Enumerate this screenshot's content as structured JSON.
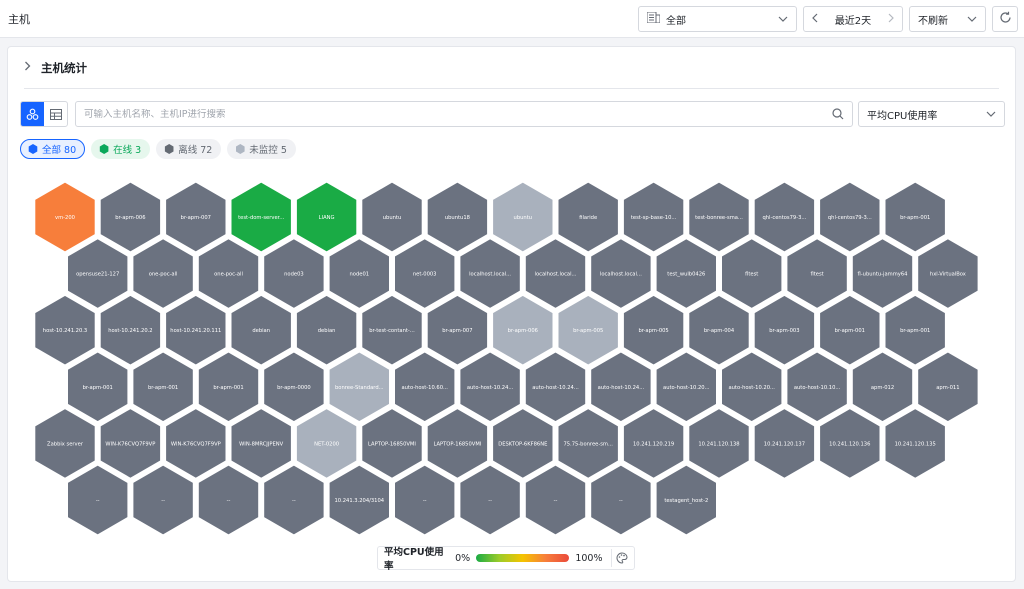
{
  "header": {
    "title": "主机",
    "scope_label": "全部",
    "time_range": "最近2天",
    "refresh_label": "不刷新"
  },
  "section": {
    "title": "主机统计"
  },
  "search": {
    "placeholder": "可输入主机名称、主机IP进行搜索"
  },
  "metric_select": {
    "value": "平均CPU使用率"
  },
  "filters": {
    "all": "全部 80",
    "online": "在线 3",
    "offline": "离线 72",
    "unmonitored": "未监控 5"
  },
  "colors": {
    "accent": "#1664ff",
    "offline": "#6b7280",
    "unmonitored": "#a9b1bd",
    "online_green": "#1aab45",
    "hot_orange": "#f77e3b"
  },
  "legend": {
    "label": "平均CPU使用率",
    "min": "0%",
    "max": "100%"
  },
  "hex_rows": [
    [
      {
        "name": "vm-200",
        "status": "hot"
      },
      {
        "name": "br-apm-006",
        "status": "offline"
      },
      {
        "name": "br-apm-007",
        "status": "offline"
      },
      {
        "name": "test-dom-server...",
        "status": "online"
      },
      {
        "name": "LIANG",
        "status": "online"
      },
      {
        "name": "ubuntu",
        "status": "offline"
      },
      {
        "name": "ubuntu18",
        "status": "offline"
      },
      {
        "name": "ubuntu",
        "status": "unmonitored"
      },
      {
        "name": "filaride",
        "status": "offline"
      },
      {
        "name": "test-sp-base-10...",
        "status": "offline"
      },
      {
        "name": "test-bonree-sma...",
        "status": "offline"
      },
      {
        "name": "qhl-centos79-3...",
        "status": "offline"
      },
      {
        "name": "qhl-centos79-3...",
        "status": "offline"
      },
      {
        "name": "br-apm-001",
        "status": "offline"
      }
    ],
    [
      {
        "name": "opensuse21-127",
        "status": "offline"
      },
      {
        "name": "one-poc-all",
        "status": "offline"
      },
      {
        "name": "one-poc-all",
        "status": "offline"
      },
      {
        "name": "node03",
        "status": "offline"
      },
      {
        "name": "node01",
        "status": "offline"
      },
      {
        "name": "net-0003",
        "status": "offline"
      },
      {
        "name": "localhost.local...",
        "status": "offline"
      },
      {
        "name": "localhost.local...",
        "status": "offline"
      },
      {
        "name": "localhost.local...",
        "status": "offline"
      },
      {
        "name": "test_wulb0426",
        "status": "offline"
      },
      {
        "name": "fltest",
        "status": "offline"
      },
      {
        "name": "fltest",
        "status": "offline"
      },
      {
        "name": "fl-ubuntu-jammy64",
        "status": "offline"
      },
      {
        "name": "hxl-VirtualBox",
        "status": "offline"
      }
    ],
    [
      {
        "name": "host-10.241.20.3",
        "status": "offline"
      },
      {
        "name": "host-10.241.20.2",
        "status": "offline"
      },
      {
        "name": "host-10.241.20.111",
        "status": "offline"
      },
      {
        "name": "debian",
        "status": "offline"
      },
      {
        "name": "debian",
        "status": "offline"
      },
      {
        "name": "br-test-contant-...",
        "status": "offline"
      },
      {
        "name": "br-apm-007",
        "status": "offline"
      },
      {
        "name": "br-apm-006",
        "status": "unmonitored"
      },
      {
        "name": "br-apm-005",
        "status": "unmonitored"
      },
      {
        "name": "br-apm-005",
        "status": "offline"
      },
      {
        "name": "br-apm-004",
        "status": "offline"
      },
      {
        "name": "br-apm-003",
        "status": "offline"
      },
      {
        "name": "br-apm-001",
        "status": "offline"
      },
      {
        "name": "br-apm-001",
        "status": "offline"
      }
    ],
    [
      {
        "name": "br-apm-001",
        "status": "offline"
      },
      {
        "name": "br-apm-001",
        "status": "offline"
      },
      {
        "name": "br-apm-001",
        "status": "offline"
      },
      {
        "name": "br-apm-0000",
        "status": "offline"
      },
      {
        "name": "bonree-Standard...",
        "status": "unmonitored"
      },
      {
        "name": "auto-host-10.60...",
        "status": "offline"
      },
      {
        "name": "auto-host-10.24...",
        "status": "offline"
      },
      {
        "name": "auto-host-10.24...",
        "status": "offline"
      },
      {
        "name": "auto-host-10.24...",
        "status": "offline"
      },
      {
        "name": "auto-host-10.20...",
        "status": "offline"
      },
      {
        "name": "auto-host-10.20...",
        "status": "offline"
      },
      {
        "name": "auto-host-10.10...",
        "status": "offline"
      },
      {
        "name": "apm-012",
        "status": "offline"
      },
      {
        "name": "apm-011",
        "status": "offline"
      }
    ],
    [
      {
        "name": "Zabbix server",
        "status": "offline"
      },
      {
        "name": "WIN-K76CVQ7F9VP",
        "status": "offline"
      },
      {
        "name": "WIN-K76CVQ7F9VP",
        "status": "offline"
      },
      {
        "name": "WIN-8MRCJJPENV",
        "status": "offline"
      },
      {
        "name": "NET-0200",
        "status": "unmonitored"
      },
      {
        "name": "LAPTOP-16850VMI",
        "status": "offline"
      },
      {
        "name": "LAPTOP-16850VMI",
        "status": "offline"
      },
      {
        "name": "DESKTOP-6KF86NE",
        "status": "offline"
      },
      {
        "name": "75.75-bonree-sm...",
        "status": "offline"
      },
      {
        "name": "10.241.120.219",
        "status": "offline"
      },
      {
        "name": "10.241.120.138",
        "status": "offline"
      },
      {
        "name": "10.241.120.137",
        "status": "offline"
      },
      {
        "name": "10.241.120.136",
        "status": "offline"
      },
      {
        "name": "10.241.120.135",
        "status": "offline"
      }
    ],
    [
      {
        "name": "--",
        "status": "offline"
      },
      {
        "name": "--",
        "status": "offline"
      },
      {
        "name": "--",
        "status": "offline"
      },
      {
        "name": "--",
        "status": "offline"
      },
      {
        "name": "10.241.3.204/3104",
        "status": "offline"
      },
      {
        "name": "--",
        "status": "offline"
      },
      {
        "name": "--",
        "status": "offline"
      },
      {
        "name": "--",
        "status": "offline"
      },
      {
        "name": "--",
        "status": "offline"
      },
      {
        "name": "testagent_host-2",
        "status": "offline"
      }
    ]
  ]
}
